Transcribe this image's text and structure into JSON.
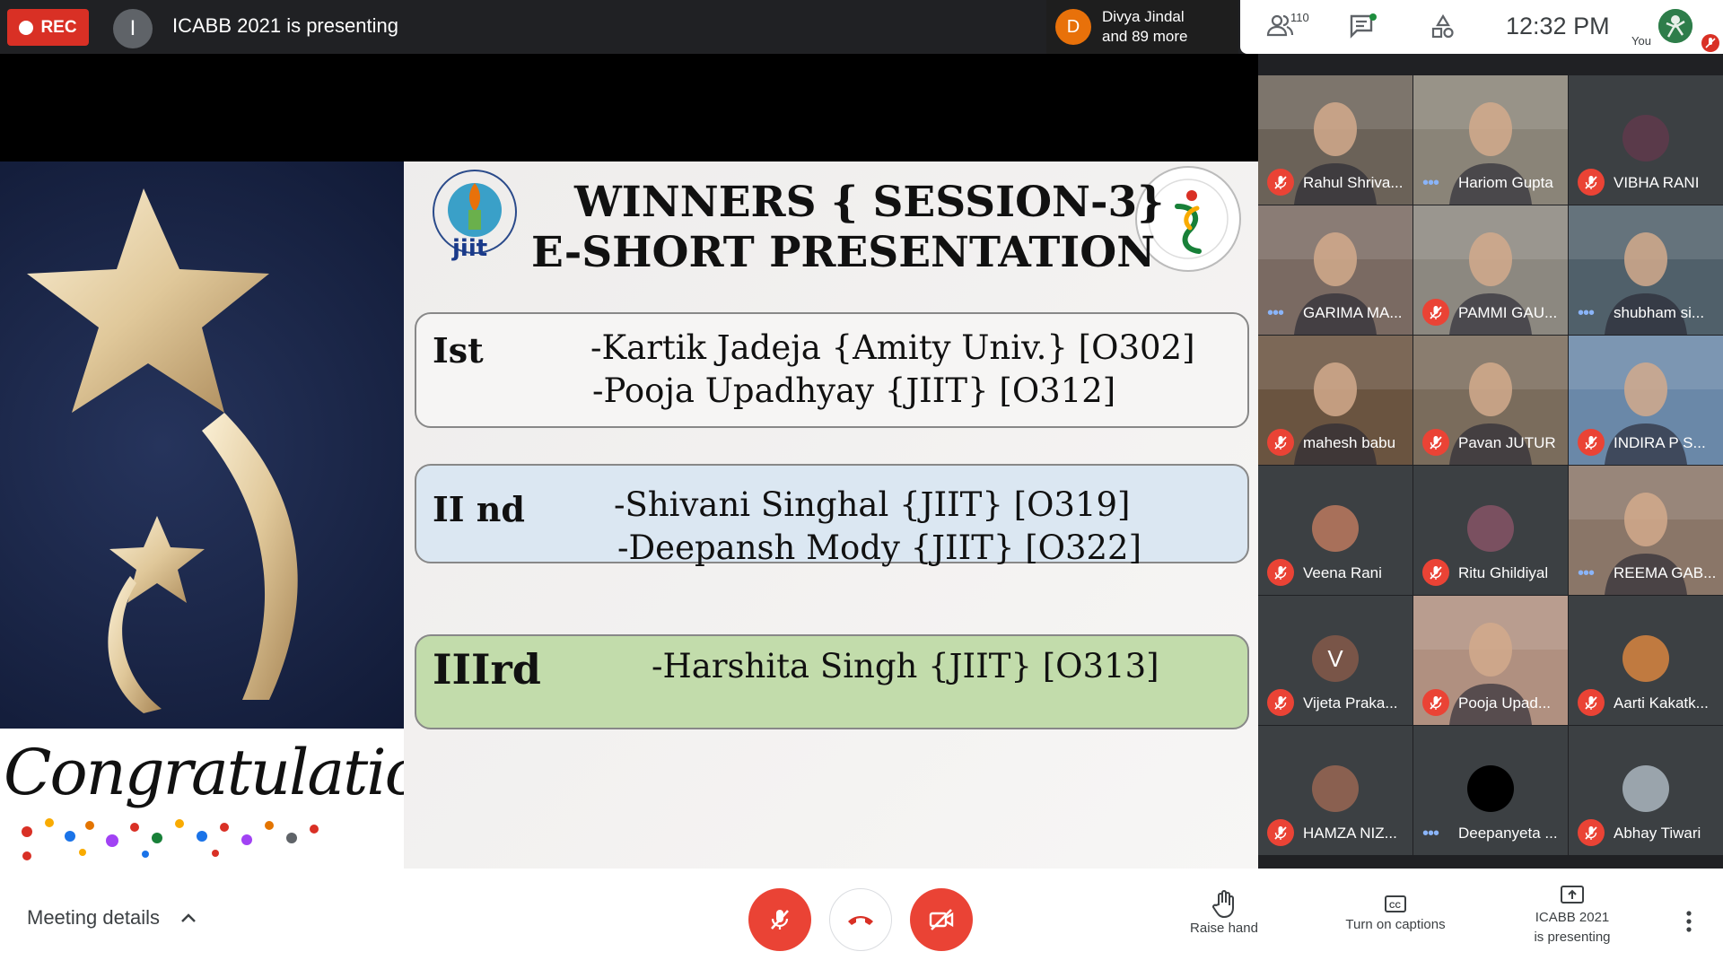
{
  "topbar": {
    "rec_label": "REC",
    "presenter_initial": "I",
    "presenting_title": "ICABB 2021 is presenting",
    "joined": {
      "initial": "D",
      "line1": "Divya Jindal",
      "line2": "and 89 more"
    },
    "participant_count": "110",
    "time": "12:32  PM",
    "you_label": "You"
  },
  "slide": {
    "heading_line1": "WINNERS { SESSION-3}",
    "heading_line2": "E-SHORT PRESENTATION",
    "congrats": "Congratulations",
    "logo_left_text": "jiit",
    "places": [
      {
        "rank": "Ist",
        "entries": [
          "-Kartik Jadeja {Amity Univ.} [O302]",
          "-Pooja Upadhyay {JIIT} [O312]"
        ]
      },
      {
        "rank": "II nd",
        "entries": [
          "-Shivani Singhal {JIIT} [O319]",
          "-Deepansh Mody {JIIT} [O322]"
        ]
      },
      {
        "rank": "IIIrd",
        "entries": [
          "-Harshita Singh {JIIT} [O313]"
        ]
      }
    ]
  },
  "participants": [
    {
      "name": "Rahul Shriva...",
      "status": "muted",
      "kind": "video",
      "color": "#6b6258"
    },
    {
      "name": "Hariom Gupta",
      "status": "speaking",
      "kind": "video",
      "color": "#8a8478"
    },
    {
      "name": "VIBHA RANI",
      "status": "muted",
      "kind": "avatar",
      "color": "#5a3a4a"
    },
    {
      "name": "GARIMA MA...",
      "status": "speaking",
      "kind": "video",
      "color": "#7a6a62"
    },
    {
      "name": "PAMMI GAU...",
      "status": "muted",
      "kind": "video",
      "color": "#8c8880"
    },
    {
      "name": "shubham si...",
      "status": "speaking",
      "kind": "video",
      "color": "#50606a"
    },
    {
      "name": "mahesh babu",
      "status": "muted",
      "kind": "video",
      "color": "#6a5440"
    },
    {
      "name": "Pavan JUTUR",
      "status": "muted",
      "kind": "video",
      "color": "#7a6c5c"
    },
    {
      "name": "INDIRA P S...",
      "status": "muted",
      "kind": "video",
      "color": "#6a88a8"
    },
    {
      "name": "Veena Rani",
      "status": "muted",
      "kind": "avatar",
      "color": "#a8705a"
    },
    {
      "name": "Ritu Ghildiyal",
      "status": "muted",
      "kind": "avatar",
      "color": "#7a5060"
    },
    {
      "name": "REEMA GAB...",
      "status": "speaking",
      "kind": "video",
      "color": "#8a7668"
    },
    {
      "name": "Vijeta Praka...",
      "status": "muted",
      "kind": "letter",
      "initial": "V",
      "color": "#795548"
    },
    {
      "name": "Pooja Upad...",
      "status": "muted",
      "kind": "video",
      "color": "#b09080"
    },
    {
      "name": "Aarti Kakatk...",
      "status": "muted",
      "kind": "avatar",
      "color": "#c07a40"
    },
    {
      "name": "HAMZA NIZ...",
      "status": "muted",
      "kind": "avatar",
      "color": "#8a6050"
    },
    {
      "name": "Deepanyeta ...",
      "status": "speaking",
      "kind": "avatar",
      "color": "#000000"
    },
    {
      "name": "Abhay Tiwari",
      "status": "muted",
      "kind": "avatar",
      "color": "#9aa4ac"
    }
  ],
  "bottombar": {
    "meeting_details": "Meeting details",
    "raise_hand": "Raise hand",
    "captions": "Turn on captions",
    "present_line1": "ICABB 2021",
    "present_line2": "is presenting"
  },
  "colors": {
    "danger": "#d93025",
    "accent": "#1a73e8",
    "dark": "#202124"
  }
}
